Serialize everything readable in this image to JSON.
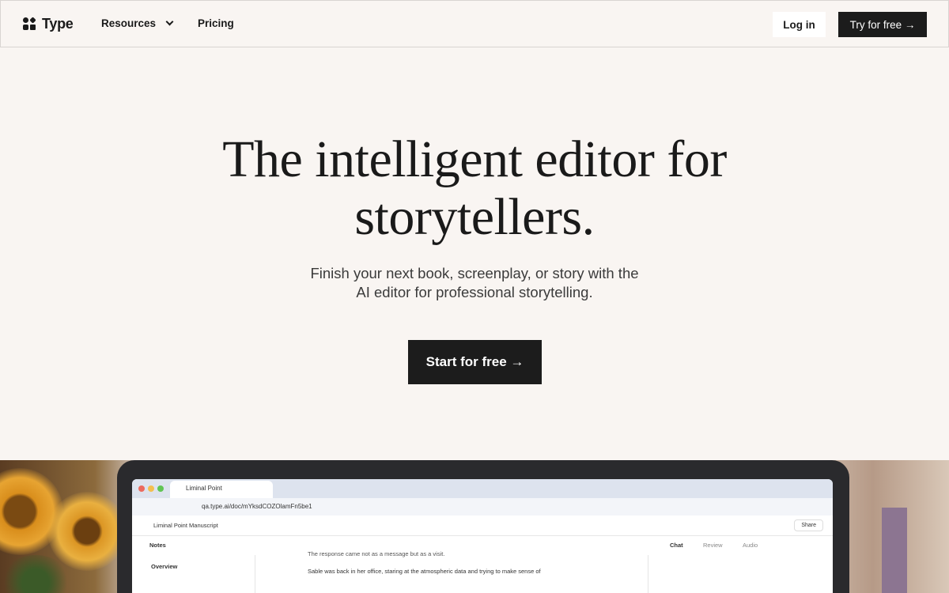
{
  "nav": {
    "brand": "Type",
    "resources": "Resources",
    "pricing": "Pricing",
    "login": "Log in",
    "try": "Try for free →"
  },
  "hero": {
    "title_line1": "The intelligent editor for",
    "title_line2": "storytellers.",
    "subtitle_line1": "Finish your next book, screenplay, or story with the",
    "subtitle_line2": "AI editor for professional storytelling.",
    "cta": "Start for free →"
  },
  "preview": {
    "tab_title": "Liminal Point",
    "url": "qa.type.ai/doc/mYksdCOZOlamFn5be1",
    "doc_title": "Liminal Point Manuscript",
    "share": "Share",
    "notes": "Notes",
    "overview": "Overview",
    "chat": "Chat",
    "review": "Review",
    "audio": "Audio",
    "line1": "The response came not as a message but as a visit.",
    "line2": "Sable was back in her office, staring at the atmospheric data and trying to make sense of"
  },
  "colors": {
    "background": "#f9f5f2",
    "dark_button": "#1c1c1c",
    "text": "#1a1a1a"
  },
  "icons": [
    "logo-icon",
    "chevron-down-icon",
    "arrow-right-icon"
  ]
}
